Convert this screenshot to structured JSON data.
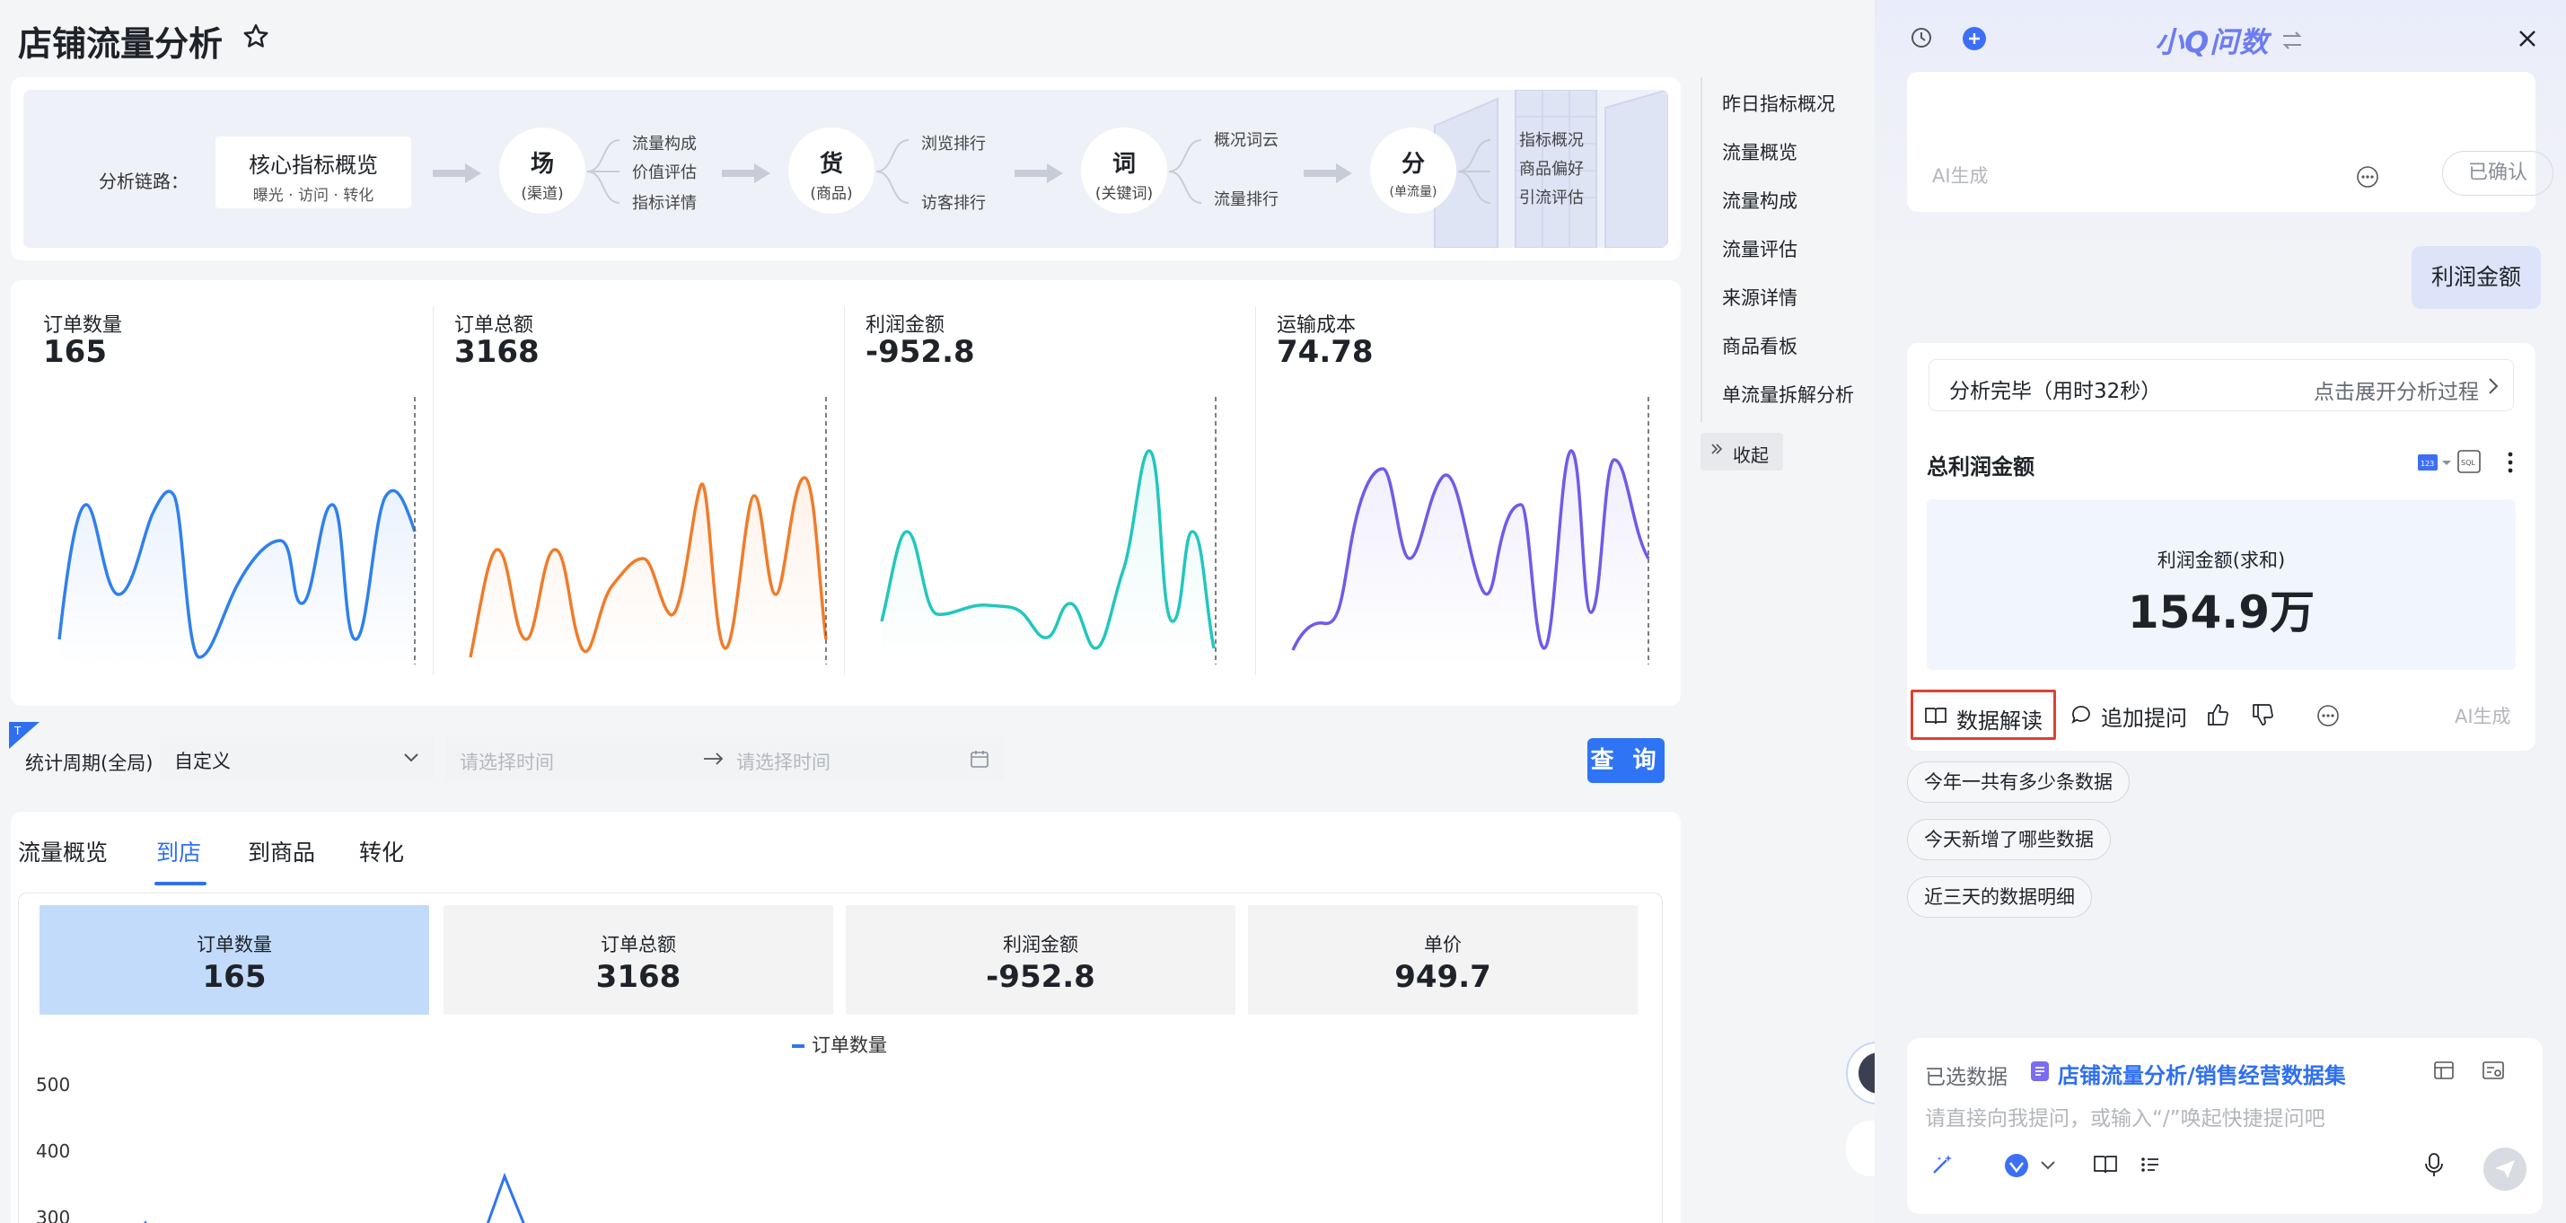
{
  "page": {
    "title": "店铺流量分析"
  },
  "chain": {
    "label": "分析链路：",
    "core": {
      "title": "核心指标概览",
      "sub": "曝光 · 访问 · 转化"
    },
    "nodes": [
      {
        "title": "场",
        "sub": "(渠道)",
        "items": [
          "流量构成",
          "价值评估",
          "指标详情"
        ]
      },
      {
        "title": "货",
        "sub": "(商品)",
        "items": [
          "浏览排行",
          "访客排行"
        ]
      },
      {
        "title": "词",
        "sub": "(关键词)",
        "items": [
          "概况词云",
          "流量排行"
        ]
      },
      {
        "title": "分",
        "sub": "(单流量)",
        "items": [
          "指标概况",
          "商品偏好",
          "引流评估"
        ]
      }
    ]
  },
  "metrics": [
    {
      "label": "订单数量",
      "value": "165",
      "color": "#2f80ed"
    },
    {
      "label": "订单总额",
      "value": "3168",
      "color": "#f07c2b"
    },
    {
      "label": "利润金额",
      "value": "-952.8",
      "color": "#22c7bd"
    },
    {
      "label": "运输成本",
      "value": "74.78",
      "color": "#6f5be8"
    }
  ],
  "filter": {
    "label": "统计周期(全局)",
    "period": "自定义",
    "start_placeholder": "请选择时间",
    "end_placeholder": "请选择时间",
    "query_label": "查 询"
  },
  "tabs": [
    {
      "label": "流量概览",
      "active": false
    },
    {
      "label": "到店",
      "active": true
    },
    {
      "label": "到商品",
      "active": false
    },
    {
      "label": "转化",
      "active": false
    }
  ],
  "kpis": [
    {
      "label": "订单数量",
      "value": "165",
      "active": true
    },
    {
      "label": "订单总额",
      "value": "3168",
      "active": false
    },
    {
      "label": "利润金额",
      "value": "-952.8",
      "active": false
    },
    {
      "label": "单价",
      "value": "949.7",
      "active": false
    }
  ],
  "chart_data": {
    "type": "line",
    "series": [
      {
        "name": "订单数量",
        "color": "#2f74f5"
      }
    ],
    "yticks": [
      "500",
      "400",
      "300"
    ]
  },
  "nav": {
    "items": [
      "昨日指标概况",
      "流量概览",
      "流量构成",
      "流量评估",
      "来源详情",
      "商品看板",
      "单流量拆解分析"
    ],
    "collapse": "收起"
  },
  "assistant": {
    "title": "小Q问数",
    "prev": {
      "ai_tag": "AI生成",
      "confirm": "已确认"
    },
    "user_message": "利润金额",
    "answer": {
      "status": "分析完毕（用时32秒）",
      "expand": "点击展开分析过程",
      "title": "总利润金额",
      "result_label": "利润金额(求和)",
      "result_value": "154.9万",
      "interpret": "数据解读",
      "followup": "追加提问",
      "ai_tag": "AI生成"
    },
    "suggestions": [
      "今年一共有多少条数据",
      "今天新增了哪些数据",
      "近三天的数据明细"
    ],
    "input": {
      "dataset_label": "已选数据",
      "dataset_name": "店铺流量分析/销售经营数据集",
      "placeholder": "请直接向我提问，或输入“/”唤起快捷提问吧"
    }
  }
}
